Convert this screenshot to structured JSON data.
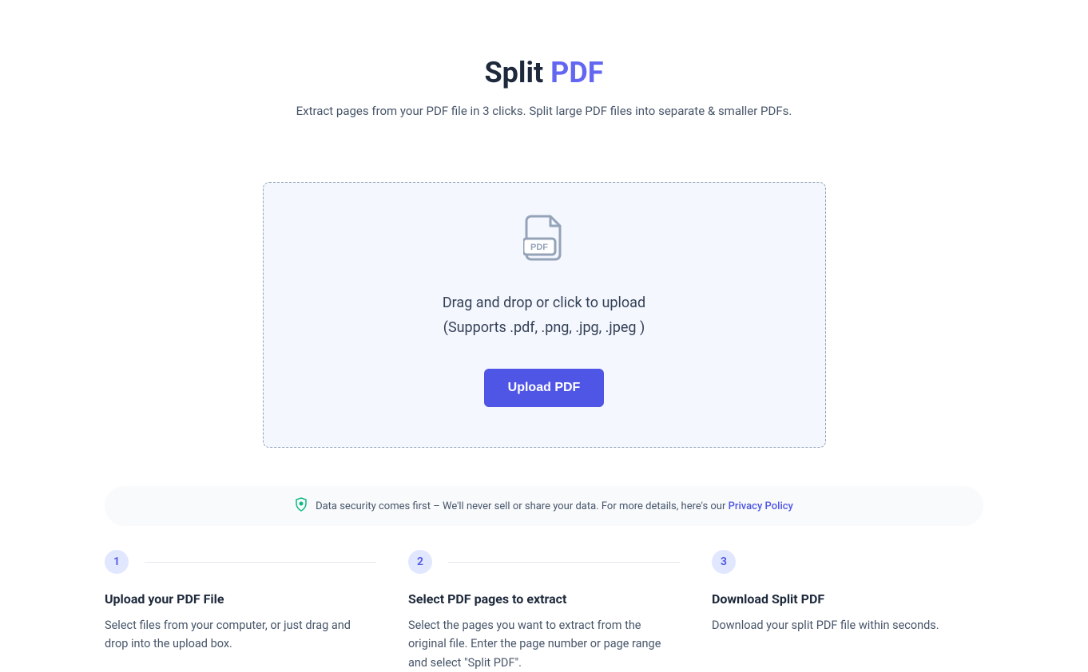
{
  "hero": {
    "title_part1": "Split ",
    "title_part2": "PDF",
    "subtitle": "Extract pages from your PDF file in 3 clicks. Split large PDF files into separate & smaller PDFs."
  },
  "dropzone": {
    "line1": "Drag and drop or click to upload",
    "line2": "(Supports .pdf, .png, .jpg, .jpeg )",
    "button_label": "Upload PDF"
  },
  "security": {
    "text_before": "Data security comes first – We'll never sell or share your data. For more details, here's our ",
    "link_label": "Privacy Policy"
  },
  "steps": [
    {
      "number": "1",
      "title": "Upload your PDF File",
      "description": "Select files from your computer, or just drag and drop into the upload box."
    },
    {
      "number": "2",
      "title": "Select PDF pages to extract",
      "description": "Select the pages you want to extract from the original file. Enter the page number or page range and select \"Split PDF\"."
    },
    {
      "number": "3",
      "title": "Download Split PDF",
      "description": "Download your split PDF file within seconds."
    }
  ]
}
